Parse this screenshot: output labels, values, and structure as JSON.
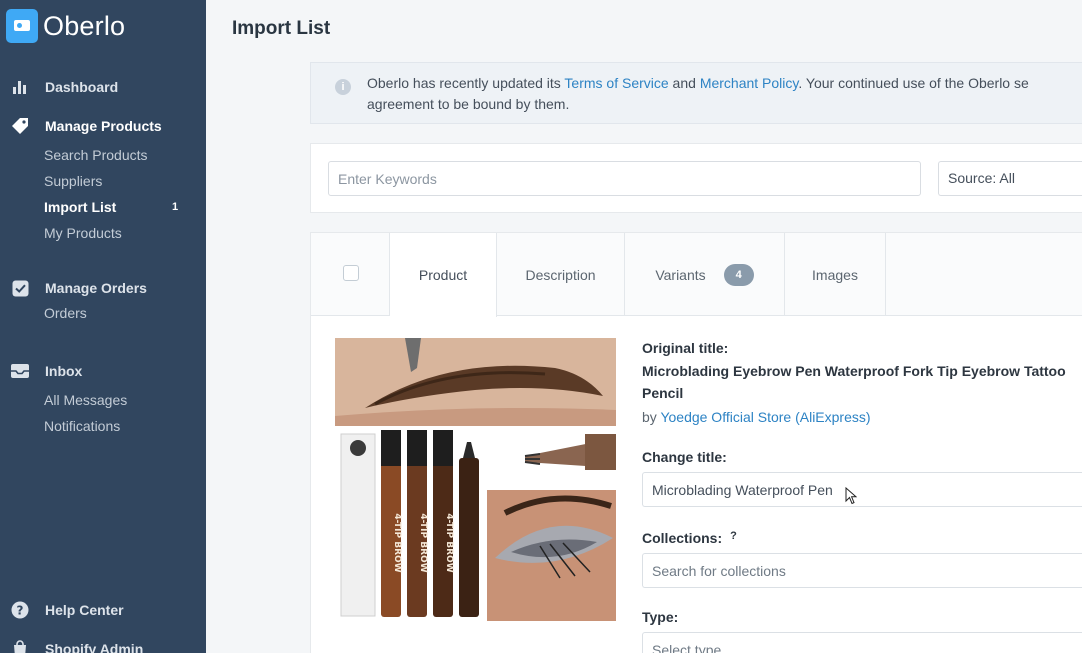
{
  "app": {
    "name": "Oberlo"
  },
  "sidebar": {
    "dashboard": "Dashboard",
    "manage_products": {
      "label": "Manage Products",
      "items": [
        {
          "label": "Search Products"
        },
        {
          "label": "Suppliers"
        },
        {
          "label": "Import List",
          "count": "1"
        },
        {
          "label": "My Products"
        }
      ]
    },
    "manage_orders": {
      "label": "Manage Orders",
      "items": [
        {
          "label": "Orders"
        }
      ]
    },
    "inbox": {
      "label": "Inbox",
      "items": [
        {
          "label": "All Messages"
        },
        {
          "label": "Notifications"
        }
      ]
    },
    "help_center": "Help Center",
    "shopify_admin": "Shopify Admin"
  },
  "page": {
    "title": "Import List"
  },
  "notice": {
    "text_1": "Oberlo has recently updated its ",
    "link_tos": "Terms of Service",
    "text_2": " and ",
    "link_merchant": "Merchant Policy",
    "text_3": ". Your continued use of the Oberlo se",
    "line_2": "agreement to be bound by them."
  },
  "search": {
    "placeholder": "Enter Keywords",
    "source": "Source: All"
  },
  "tabs": [
    {
      "label": "Product"
    },
    {
      "label": "Description"
    },
    {
      "label": "Variants",
      "badge": "4"
    },
    {
      "label": "Images"
    }
  ],
  "product": {
    "original_title_label": "Original title:",
    "original_title": "Microblading Eyebrow Pen Waterproof Fork Tip Eyebrow Tattoo Pencil",
    "by_prefix": "by ",
    "store": "Yoedge Official Store (AliExpress)",
    "change_title_label": "Change title:",
    "change_title_value": "Microblading Waterproof Pen",
    "collections_label": "Collections:",
    "collections_help": "?",
    "collections_placeholder": "Search for collections",
    "type_label": "Type:",
    "type_placeholder": "Select type",
    "pen_label": "4-TIP BROW"
  },
  "colors": {
    "sidebar_bg": "#31465f",
    "brand": "#3fa9f5",
    "link": "#2d83c4"
  }
}
